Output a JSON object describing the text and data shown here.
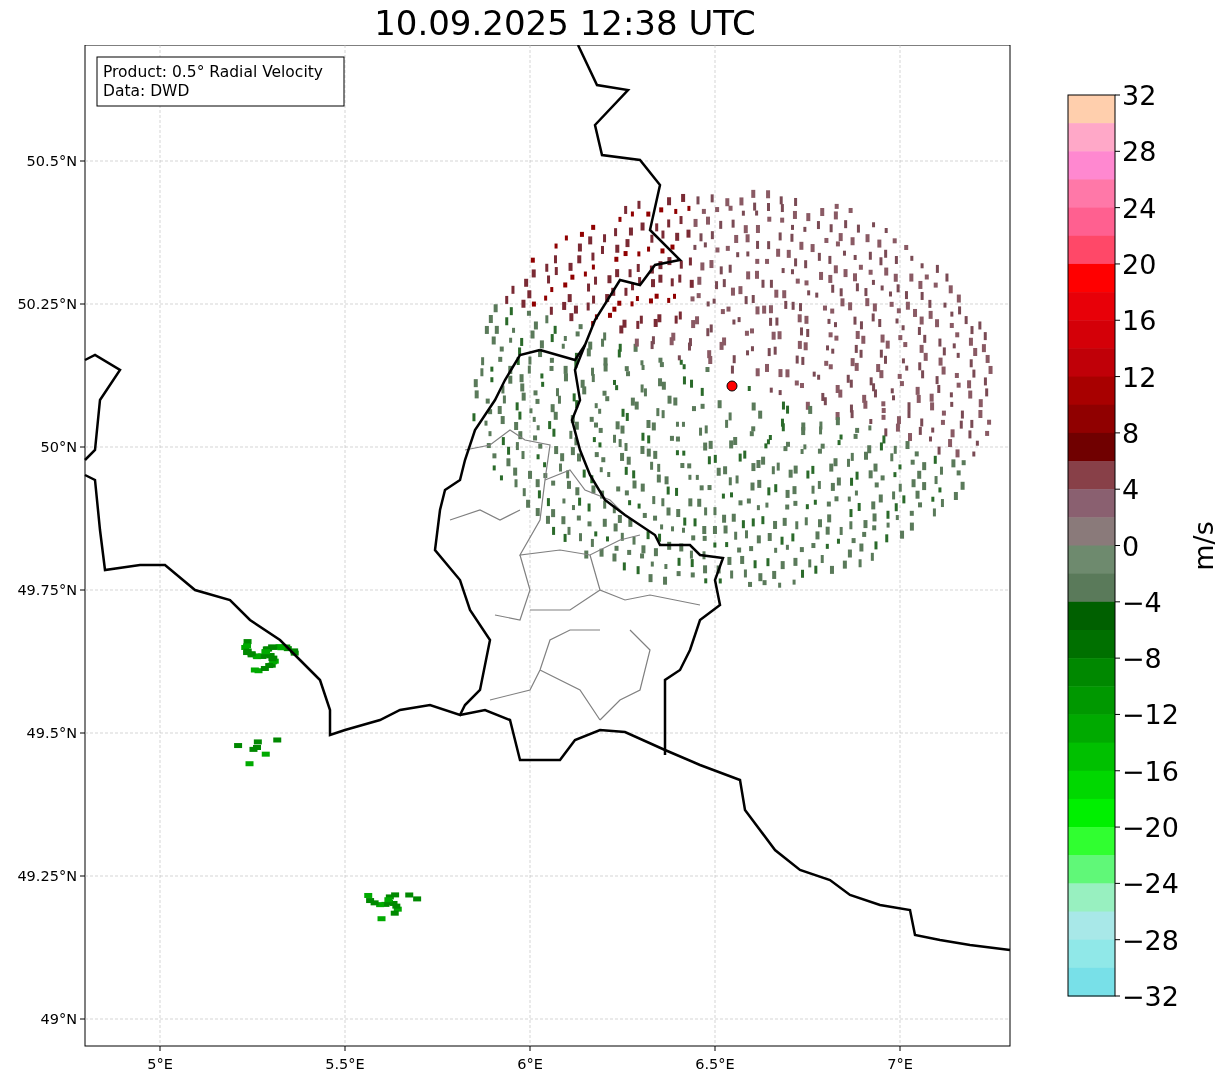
{
  "title": "10.09.2025 12:38 UTC",
  "info_box": [
    "Product: 0.5° Radial Velocity",
    "Data: DWD"
  ],
  "map": {
    "lat_ticks": [
      "50.5°N",
      "50.25°N",
      "50°N",
      "49.75°N",
      "49.5°N",
      "49.25°N",
      "49°N"
    ],
    "lon_ticks": [
      "5°E",
      "5.5°E",
      "6°E",
      "6.5°E",
      "7°E"
    ]
  },
  "colorbar": {
    "label": "m/s",
    "ticks": [
      "32",
      "28",
      "24",
      "20",
      "16",
      "12",
      "8",
      "4",
      "0",
      "−4",
      "−8",
      "−12",
      "−16",
      "−20",
      "−24",
      "−28",
      "−32"
    ],
    "segments": [
      {
        "color": "#ffcfad"
      },
      {
        "color": "#ffa8c8"
      },
      {
        "color": "#ff88d0"
      },
      {
        "color": "#ff78a8"
      },
      {
        "color": "#ff6090"
      },
      {
        "color": "#ff4868"
      },
      {
        "color": "#ff0000"
      },
      {
        "color": "#e80008"
      },
      {
        "color": "#d40008"
      },
      {
        "color": "#c00008"
      },
      {
        "color": "#a80000"
      },
      {
        "color": "#900000"
      },
      {
        "color": "#700000"
      },
      {
        "color": "#884048"
      },
      {
        "color": "#8a6070"
      },
      {
        "color": "#8a7a7a"
      },
      {
        "color": "#6e8a6e"
      },
      {
        "color": "#5a7a5a"
      },
      {
        "color": "#006000"
      },
      {
        "color": "#007000"
      },
      {
        "color": "#008800"
      },
      {
        "color": "#009800"
      },
      {
        "color": "#00aa00"
      },
      {
        "color": "#00c000"
      },
      {
        "color": "#00d800"
      },
      {
        "color": "#00f000"
      },
      {
        "color": "#30ff30"
      },
      {
        "color": "#60f878"
      },
      {
        "color": "#98f0c0"
      },
      {
        "color": "#a8e8e8"
      },
      {
        "color": "#90e8e8"
      },
      {
        "color": "#78e0e8"
      }
    ]
  }
}
